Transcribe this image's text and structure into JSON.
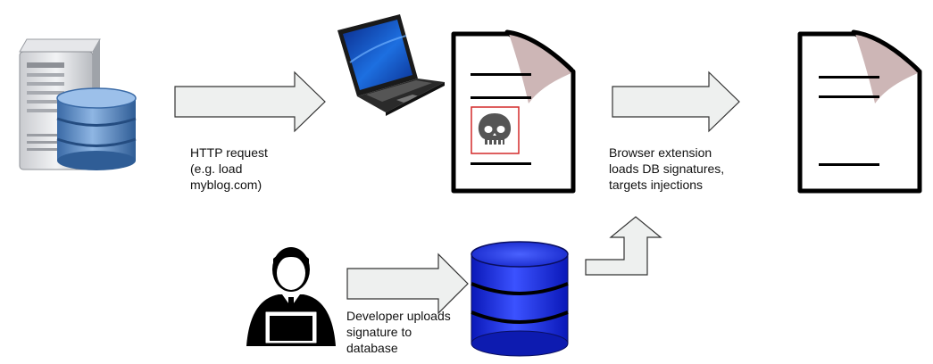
{
  "diagram": {
    "labels": {
      "http_request": [
        "HTTP request",
        "(e.g. load",
        "myblog.com)"
      ],
      "browser_extension": [
        "Browser extension",
        "loads DB signatures,",
        "targets injections"
      ],
      "developer_uploads": [
        "Developer uploads",
        "signature to",
        "database"
      ]
    },
    "colors": {
      "arrow_fill": "#eef0ef",
      "arrow_stroke": "#333333",
      "database_blue": "#1a2fe0",
      "server_db_blue": "#4f7fb8",
      "document_stroke": "#000000",
      "skull_frame": "#d42a2a"
    },
    "icons": [
      "server-database-icon",
      "laptop-icon",
      "infected-document-icon",
      "skull-icon",
      "clean-document-icon",
      "developer-icon",
      "database-icon"
    ]
  }
}
